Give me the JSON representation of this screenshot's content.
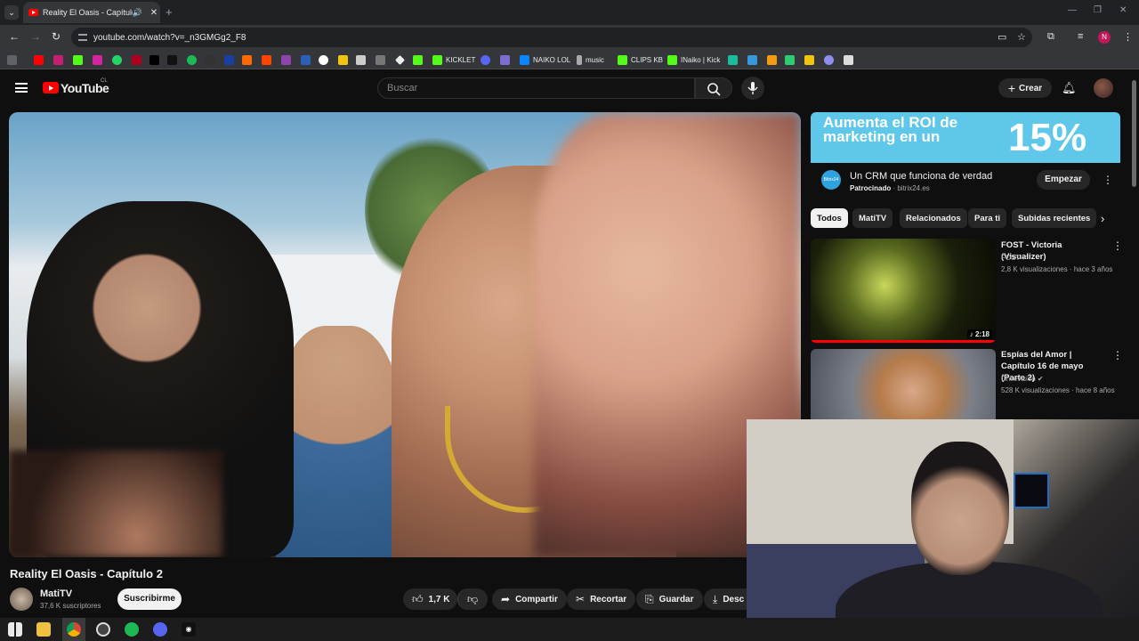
{
  "browser": {
    "tab_title": "Reality El Oasis - Capítulo 2",
    "tab_audio": "🔊",
    "tab_close": "✕",
    "new_tab": "+",
    "url": "youtube.com/watch?v=_n3GMGg2_F8",
    "profile_initial": "N",
    "bookmarks": [
      "KICKLET",
      "NAIKO LOL",
      "music",
      "CLIPS KB",
      "INaiko | Kick"
    ]
  },
  "youtube": {
    "logo": "YouTube",
    "region": "CL",
    "search_placeholder": "Buscar",
    "create_label": "Crear",
    "create_icon": "+"
  },
  "video": {
    "title": "Reality El Oasis - Capítulo 2",
    "channel": "MatiTV",
    "subscribers": "37,6 K suscriptores",
    "subscribe_label": "Suscribirme",
    "likes": "1,7 K",
    "share_label": "Compartir",
    "clip_label": "Recortar",
    "save_label": "Guardar",
    "download_label": "Desc"
  },
  "ad": {
    "banner_text": "Aumenta el ROI de marketing en un",
    "banner_percent": "15%",
    "title": "Un CRM que funciona de verdad",
    "sponsored": "Patrocinado",
    "domain": "bitrix24.es",
    "cta": "Empezar",
    "logo_text": "Bitrix24"
  },
  "chips": [
    "Todos",
    "MatiTV",
    "Relacionados",
    "Para ti",
    "Subidas recientes"
  ],
  "recommendations": [
    {
      "title": "FOST - Victoria (Visualizer)",
      "channel": "FOST",
      "meta": "2,8 K visualizaciones · hace 3 años",
      "duration": "2:18"
    },
    {
      "title": "Espías del Amor | Capítulo 16 de mayo (Parte 2)",
      "channel": "Chilevisión",
      "meta": "528 K visualizaciones · hace 8 años"
    }
  ],
  "colors": {
    "accent": "#ff0000",
    "background": "#0f0f0f",
    "ad_banner": "#5fc8ea"
  }
}
